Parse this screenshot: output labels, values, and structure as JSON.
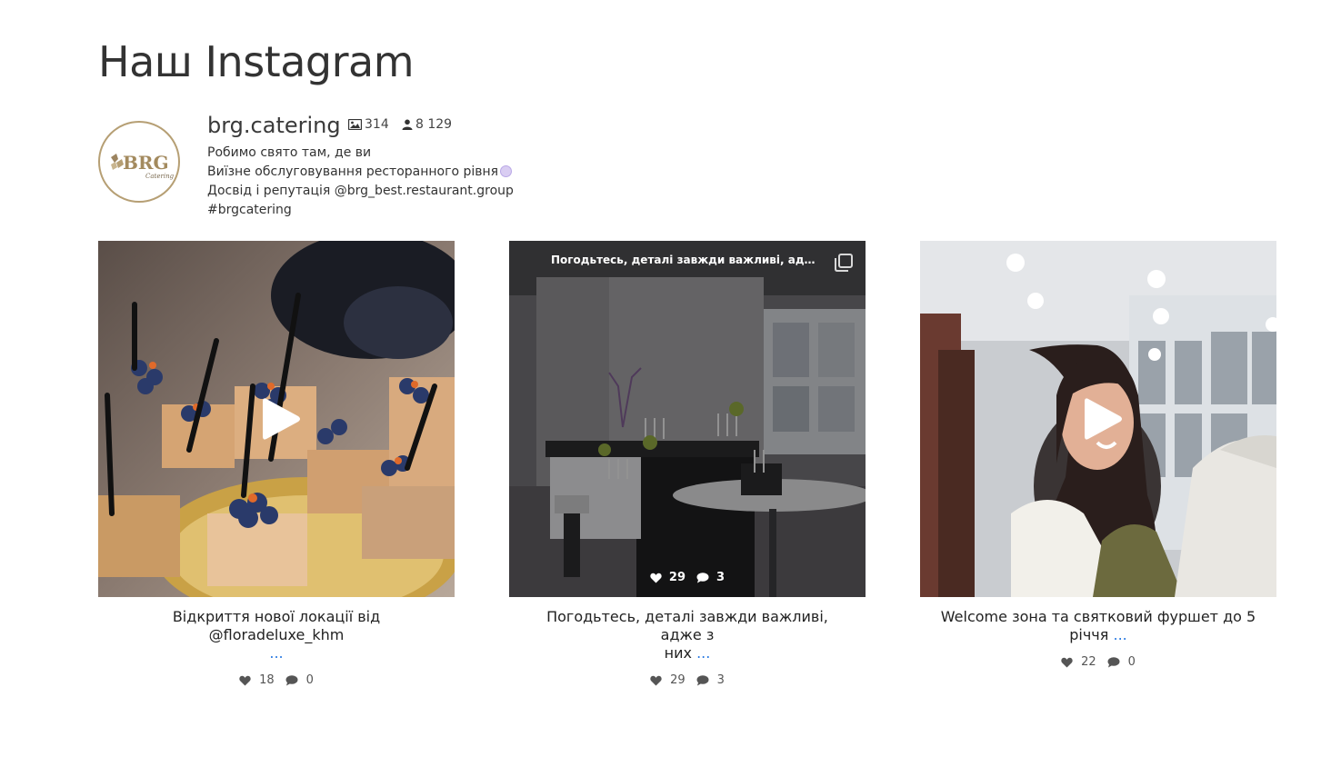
{
  "section": {
    "title": "Наш Instagram"
  },
  "profile": {
    "username": "brg.catering",
    "posts_count": "314",
    "followers_count": "8 129",
    "bio": [
      "Робимо свято там, де ви",
      "Виїзне обслуговування ресторанного рівня",
      "Досвід і репутація @brg_best.restaurant.group",
      "#brgcatering"
    ],
    "logo_text": "BRG",
    "logo_subtext": "Catering",
    "accent_color": "#b69f74"
  },
  "posts": [
    {
      "caption_line1": "Відкриття нової локації від",
      "caption_line2": "@floradeluxe_khm",
      "more": "...",
      "likes": "18",
      "comments": "0",
      "type": "video"
    },
    {
      "caption_line1": "Погодьтесь, деталі завжди важливі, адже з",
      "caption_line2": "них",
      "more": "...",
      "likes": "29",
      "comments": "3",
      "type": "carousel",
      "hover_caption": "Погодьтесь, деталі завжди важливі, адже з них...",
      "hover_likes": "29",
      "hover_comments": "3"
    },
    {
      "caption_line1": "Welcome зона та святковий фуршет до 5",
      "caption_line2": "річчя",
      "more": "...",
      "likes": "22",
      "comments": "0",
      "type": "video"
    }
  ],
  "icons": {
    "posts": "image-icon",
    "followers": "user-icon",
    "likes": "heart-icon",
    "comments": "comment-icon",
    "play": "play-icon",
    "carousel": "carousel-icon"
  }
}
